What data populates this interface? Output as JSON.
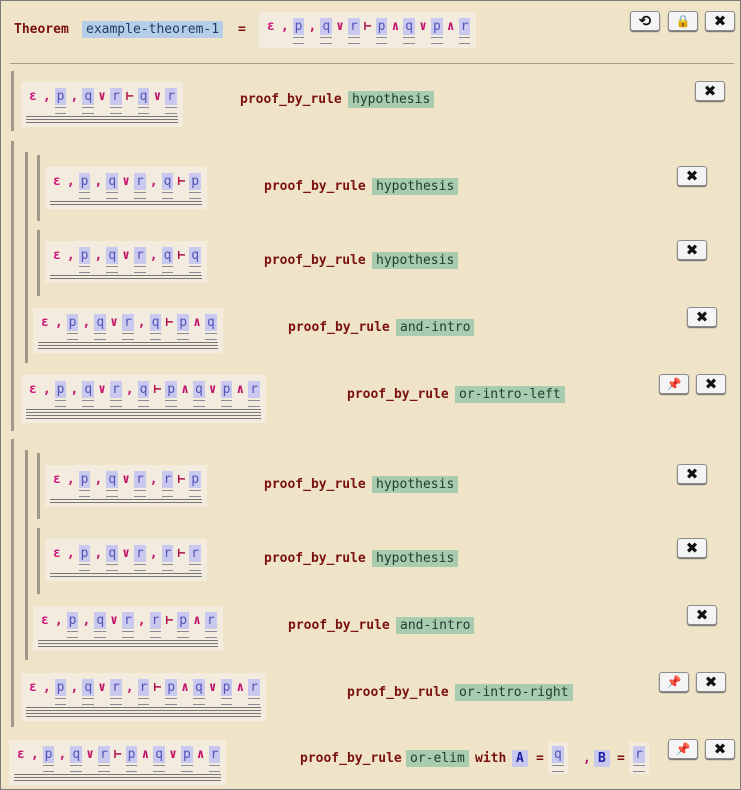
{
  "header": {
    "theorem_label": "Theorem",
    "theorem_name": "example-theorem-1",
    "equals": "=",
    "statement": [
      "ε",
      ",",
      "p",
      ",",
      "q",
      "∨",
      "r",
      "⊢",
      "p",
      "∧",
      "q",
      "∨",
      "p",
      "∧",
      "r"
    ],
    "reset_icon": "⟲",
    "lock_icon": "🔒",
    "close_icon": "✖"
  },
  "proof": {
    "keyword": "proof_by_rule",
    "with_keyword": "with",
    "close_icon": "✖",
    "pin_icon": "📌",
    "steps": [
      {
        "tokens": [
          "ε",
          ",",
          "p",
          ",",
          "q",
          "∨",
          "r",
          "⊢",
          "q",
          "∨",
          "r"
        ],
        "rule": "hypothesis"
      },
      {
        "tokens": [
          "ε",
          ",",
          "p",
          ",",
          "q",
          "∨",
          "r",
          ",",
          "q",
          "⊢",
          "p"
        ],
        "rule": "hypothesis"
      },
      {
        "tokens": [
          "ε",
          ",",
          "p",
          ",",
          "q",
          "∨",
          "r",
          ",",
          "q",
          "⊢",
          "q"
        ],
        "rule": "hypothesis"
      },
      {
        "tokens": [
          "ε",
          ",",
          "p",
          ",",
          "q",
          "∨",
          "r",
          ",",
          "q",
          "⊢",
          "p",
          "∧",
          "q"
        ],
        "rule": "and-intro"
      },
      {
        "tokens": [
          "ε",
          ",",
          "p",
          ",",
          "q",
          "∨",
          "r",
          ",",
          "q",
          "⊢",
          "p",
          "∧",
          "q",
          "∨",
          "p",
          "∧",
          "r"
        ],
        "rule": "or-intro-left"
      },
      {
        "tokens": [
          "ε",
          ",",
          "p",
          ",",
          "q",
          "∨",
          "r",
          ",",
          "r",
          "⊢",
          "p"
        ],
        "rule": "hypothesis"
      },
      {
        "tokens": [
          "ε",
          ",",
          "p",
          ",",
          "q",
          "∨",
          "r",
          ",",
          "r",
          "⊢",
          "r"
        ],
        "rule": "hypothesis"
      },
      {
        "tokens": [
          "ε",
          ",",
          "p",
          ",",
          "q",
          "∨",
          "r",
          ",",
          "r",
          "⊢",
          "p",
          "∧",
          "r"
        ],
        "rule": "and-intro"
      },
      {
        "tokens": [
          "ε",
          ",",
          "p",
          ",",
          "q",
          "∨",
          "r",
          ",",
          "r",
          "⊢",
          "p",
          "∧",
          "q",
          "∨",
          "p",
          "∧",
          "r"
        ],
        "rule": "or-intro-right"
      },
      {
        "tokens": [
          "ε",
          ",",
          "p",
          ",",
          "q",
          "∨",
          "r",
          "⊢",
          "p",
          "∧",
          "q",
          "∨",
          "p",
          "∧",
          "r"
        ],
        "rule": "or-elim"
      }
    ],
    "final_with": {
      "a_name": "A",
      "a_value": "q",
      "b_name": "B",
      "b_value": "r",
      "equals": "=",
      "comma": ","
    }
  }
}
